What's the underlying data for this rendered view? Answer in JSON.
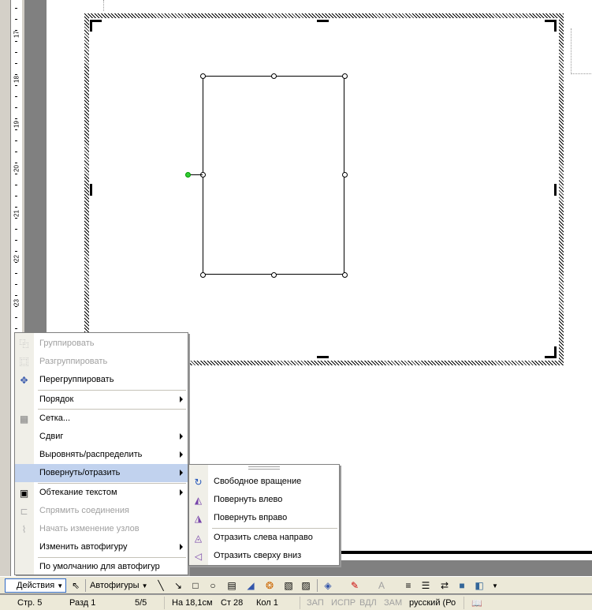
{
  "ruler": {
    "numbers": [
      "17",
      "18",
      "19",
      "20",
      "21",
      "22",
      "23"
    ]
  },
  "context_menu": {
    "items": [
      {
        "label": "Группировать",
        "icon": "group-icon",
        "disabled": true
      },
      {
        "label": "Разгруппировать",
        "icon": "ungroup-icon",
        "disabled": true
      },
      {
        "label": "Перегруппировать",
        "icon": "regroup-icon",
        "disabled": false
      },
      {
        "label": "Порядок",
        "submenu": true
      },
      {
        "label": "Сетка...",
        "icon": "grid-icon"
      },
      {
        "label": "Сдвиг",
        "submenu": true
      },
      {
        "label": "Выровнять/распределить",
        "submenu": true
      },
      {
        "label": "Повернуть/отразить",
        "submenu": true,
        "highlighted": true
      },
      {
        "label": "Обтекание текстом",
        "icon": "text-wrap-icon",
        "submenu": true
      },
      {
        "label": "Спрямить соединения",
        "icon": "straighten-connectors-icon",
        "disabled": true
      },
      {
        "label": "Начать изменение узлов",
        "icon": "edit-points-icon",
        "disabled": true
      },
      {
        "label": "Изменить автофигуру",
        "submenu": true
      },
      {
        "label": "По умолчанию для автофигур"
      }
    ]
  },
  "rotate_submenu": {
    "items": [
      {
        "label": "Свободное вращение",
        "icon": "free-rotate-icon"
      },
      {
        "label": "Повернуть влево",
        "icon": "rotate-left-icon"
      },
      {
        "label": "Повернуть вправо",
        "icon": "rotate-right-icon"
      },
      {
        "label": "Отразить слева направо",
        "icon": "flip-horizontal-icon"
      },
      {
        "label": "Отразить сверху вниз",
        "icon": "flip-vertical-icon"
      }
    ]
  },
  "drawing_toolbar": {
    "actions_label": "Действия",
    "autoshapes_label": "Автофигуры"
  },
  "status_bar": {
    "page": "Стр. 5",
    "section": "Разд 1",
    "page_of": "5/5",
    "position": "На 18,1см",
    "line": "Ст 28",
    "column": "Кол 1",
    "rec": "ЗАП",
    "trk": "ИСПР",
    "ext": "ВДЛ",
    "ovr": "ЗАМ",
    "language": "русский (Ро"
  },
  "colors": {
    "menu_highlight": "#c1d2ee",
    "rotation_handle": "#33cc33",
    "line_color": "#cc0000",
    "fill_color": "#ffcc00"
  }
}
